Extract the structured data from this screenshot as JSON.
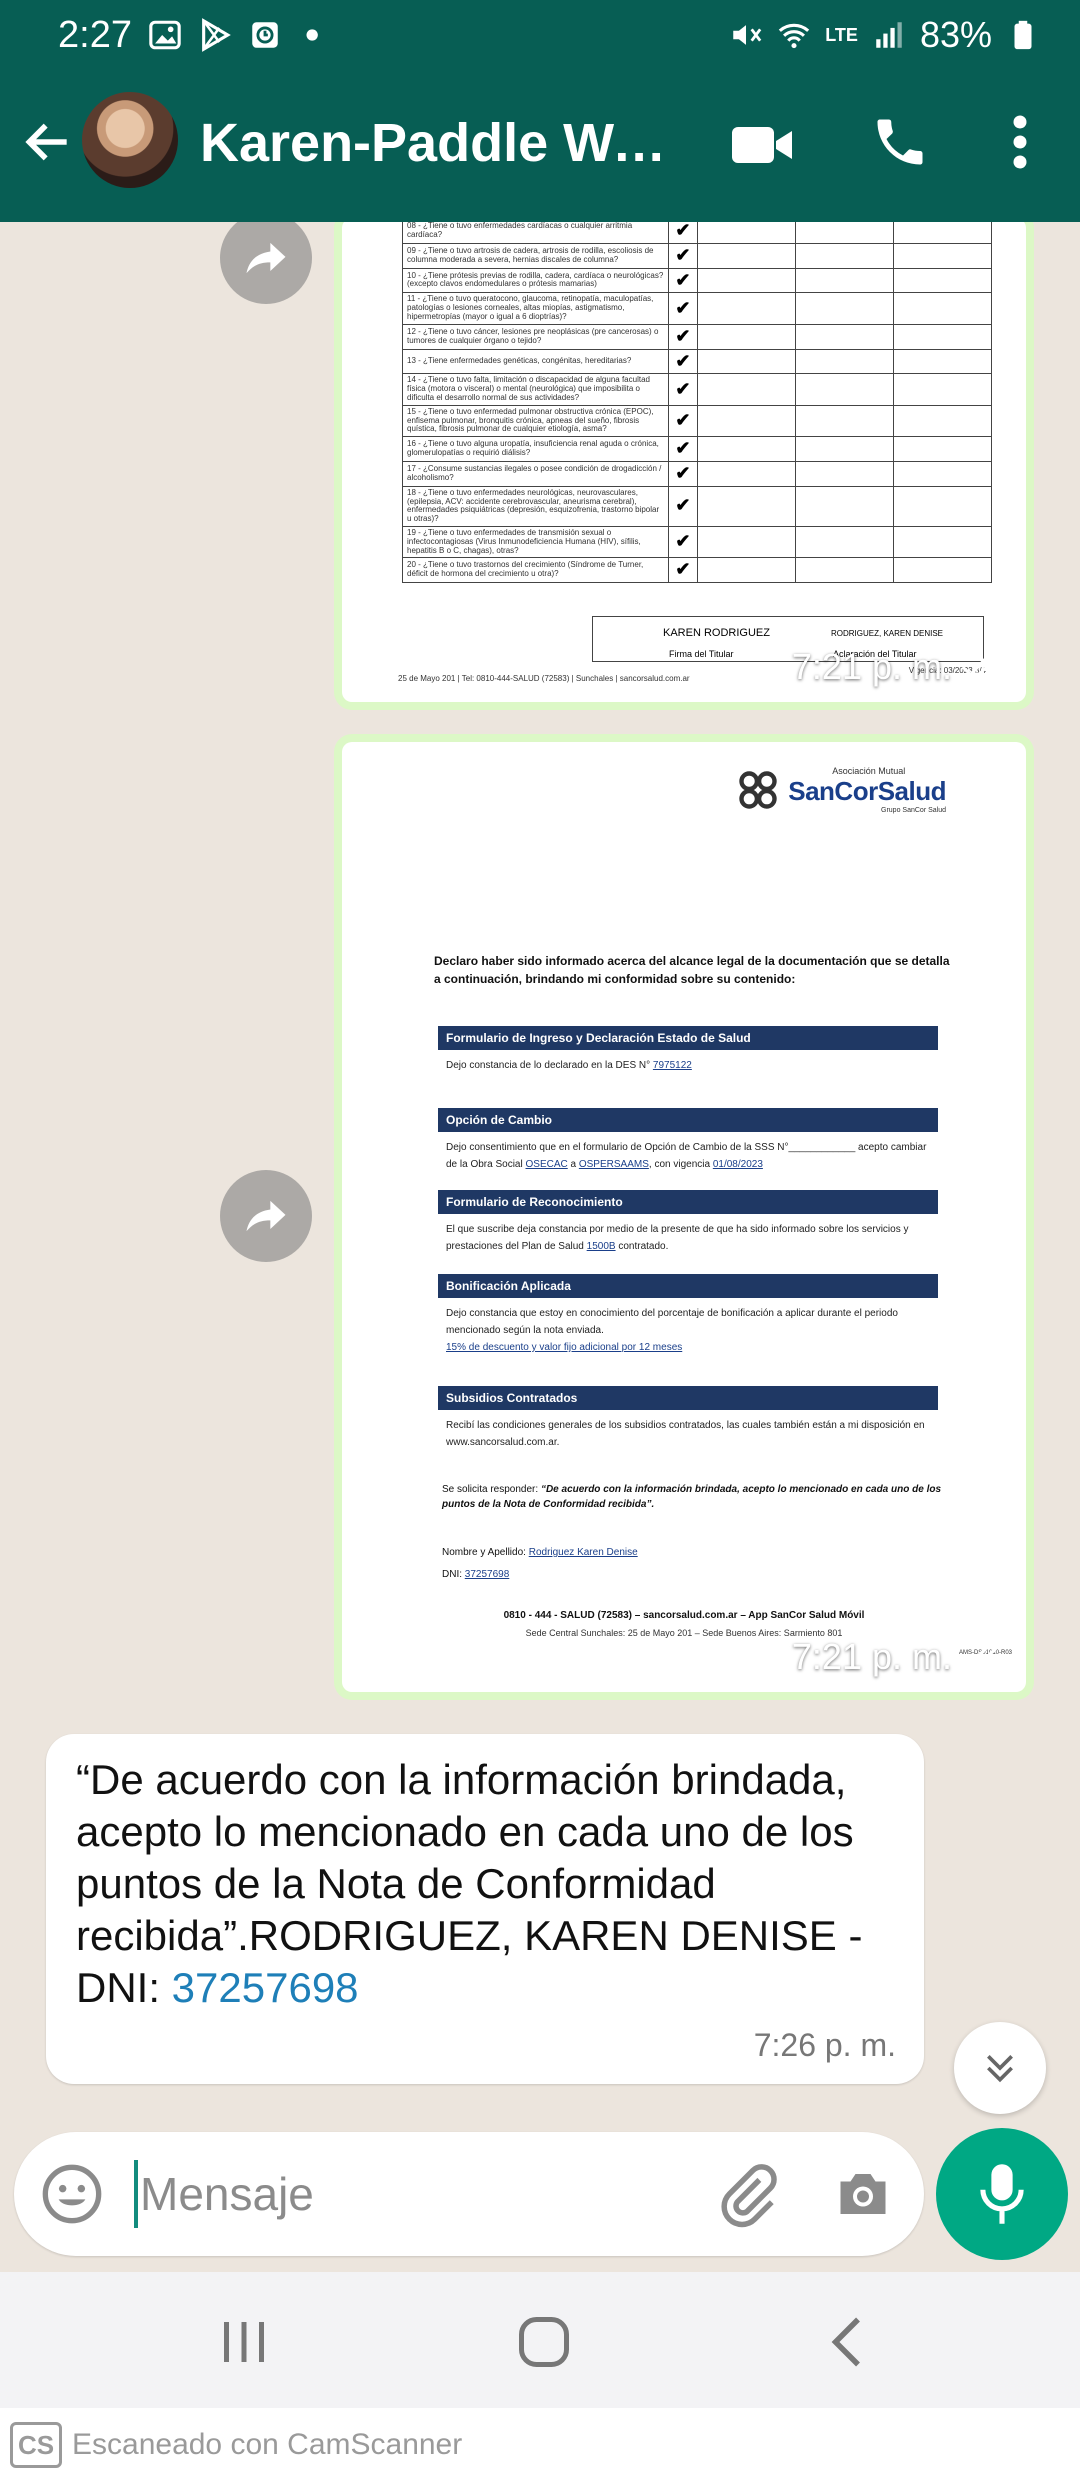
{
  "status_bar": {
    "time": "2:27",
    "battery": "83%",
    "network": "LTE"
  },
  "header": {
    "contact_name": "Karen-Paddle Watc..."
  },
  "messages": {
    "image1": {
      "time": "7:21 p. m.",
      "rows": [
        "08 - ¿Tiene o tuvo enfermedades cardíacas o cualquier arritmia cardíaca?",
        "09 - ¿Tiene o tuvo artrosis de cadera, artrosis de rodilla, escoliosis de columna moderada a severa, hernias discales de columna?",
        "10 - ¿Tiene prótesis previas de rodilla, cadera, cardíaca o neurológicas? (excepto clavos endomedulares o prótesis mamarias)",
        "11 - ¿Tiene o tuvo queratocono, glaucoma, retinopatía, maculopatías, patologías o lesiones corneales, altas miopías, astigmatismo, hipermetropías (mayor o igual a 6 dioptrías)?",
        "12 - ¿Tiene o tuvo cáncer, lesiones pre neoplásicas (pre cancerosas) o tumores de cualquier órgano o tejido?",
        "13 - ¿Tiene enfermedades genéticas, congénitas, hereditarias?",
        "14 - ¿Tiene o tuvo falta, limitación o discapacidad de alguna facultad física (motora o visceral) o mental (neurológica) que imposibilita o dificulta el desarrollo normal de sus actividades?",
        "15 - ¿Tiene o tuvo enfermedad pulmonar obstructiva crónica (EPOC), enfisema pulmonar, bronquitis crónica, apneas del sueño, fibrosis quística, fibrosis pulmonar de cualquier etiología, asma?",
        "16 - ¿Tiene o tuvo alguna uropatía, insuficiencia renal aguda o crónica, glomerulopatías o requirió diálisis?",
        "17 - ¿Consume sustancias ilegales o posee condición de drogadicción / alcoholismo?",
        "18 - ¿Tiene o tuvo enfermedades neurológicas, neurovasculares, (epilepsia, ACV: accidente cerebrovascular, aneurisma cerebral), enfermedades psiquiátricas (depresión, esquizofrenia, trastorno bipolar u otras)?",
        "19 - ¿Tiene o tuvo enfermedades de transmisión sexual o infectocontagiosas (Virus Inmunodeficiencia Humana (HIV), sífilis, hepatitis B o C, chagas), otras?",
        "20 - ¿Tiene o tuvo trastornos del crecimiento (Síndrome de Turner, déficit de hormona del crecimiento u otra)?"
      ],
      "check": "✔",
      "signature_name": "KAREN RODRIGUEZ",
      "clarification_name": "RODRIGUEZ, KAREN DENISE",
      "signature_label": "Firma del Titular",
      "clarification_label": "Aclaración del Titular",
      "footer": "25 de Mayo 201 | Tel: 0810-444-SALUD (72583) | Sunchales | sancorsalud.com.ar",
      "page": "Vigencia: 03/2023 3/4"
    },
    "image2": {
      "time": "7:21 p. m.",
      "logo_small": "Asociación Mutual",
      "logo_big": "SanCorSalud",
      "logo_group": "Grupo SanCor Salud",
      "declaration": "Declaro haber sido informado acerca del alcance legal de la documentación que se detalla a continuación, brindando mi conformidad sobre su contenido:",
      "sections": [
        {
          "header": "Formulario de Ingreso y Declaración Estado de Salud",
          "pre": "Dejo constancia de lo declarado en la DES N°",
          "value": "7975122"
        },
        {
          "header": "Opción de Cambio",
          "pre": "Dejo consentimiento que en el formulario de Opción de Cambio de la SSS N°____________ acepto cambiar de la Obra Social",
          "value": "OSECAC",
          "mid": " a ",
          "value2": "OSPERSAAMS",
          "post": ", con vigencia ",
          "value3": "01/08/2023"
        },
        {
          "header": "Formulario de Reconocimiento",
          "pre": "El que suscribe deja constancia por medio de la presente de que ha sido informado sobre los servicios y prestaciones del Plan de Salud",
          "value": "1500B",
          "post": " contratado."
        },
        {
          "header": "Bonificación Aplicada",
          "pre": "Dejo constancia que estoy en conocimiento del porcentaje de bonificación a aplicar durante el periodo mencionado según la nota enviada.",
          "value": "15% de descuento y valor fijo adicional por 12 meses"
        },
        {
          "header": "Subsidios Contratados",
          "pre": "Recibí las condiciones generales de los subsidios contratados, las cuales también están a mi disposición en www.sancorsalud.com.ar."
        }
      ],
      "solicit_pre": "Se solicita responder:",
      "solicit_quote": "“De acuerdo con la información brindada, acepto lo mencionado en cada uno de los puntos de la Nota de Conformidad recibida”.",
      "name_label": "Nombre y Apellido:",
      "name_value": "Rodriguez Karen Denise",
      "dni_label": "DNI:",
      "dni_value": "37257698",
      "footer_bold": "0810 - 444 - SALUD (72583) – sancorsalud.com.ar – App SanCor Salud Móvil",
      "footer_small": "Sede Central Sunchales: 25 de Mayo 201 – Sede Buenos Aires: Sarmiento 801",
      "code": "AMS-DS01010-R03"
    },
    "text": {
      "body": "“De acuerdo con la información brindada, acepto lo mencionado en cada uno de los puntos de la Nota de Conformidad recibida”.RODRIGUEZ, KAREN DENISE -  DNI: ",
      "dni": "37257698",
      "time": "7:26 p. m."
    }
  },
  "composer": {
    "placeholder": "Mensaje"
  },
  "footer": {
    "logo": "CS",
    "label": "Escaneado con CamScanner"
  },
  "colors": {
    "header": "#075e54",
    "outgoing": "#dcf8c6",
    "accent": "#00a884",
    "section_header": "#1f3864"
  }
}
